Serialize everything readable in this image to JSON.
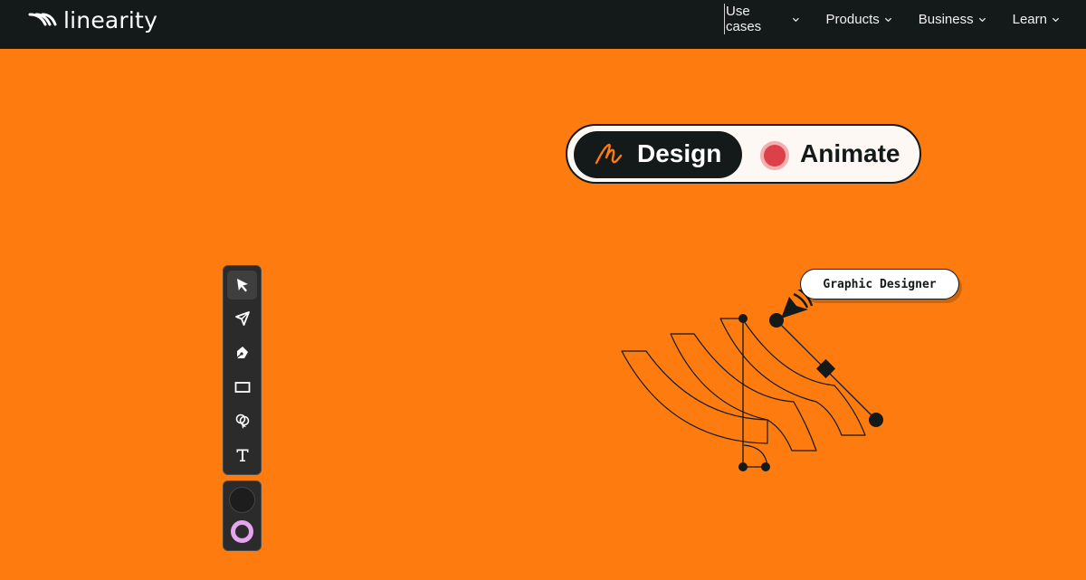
{
  "header": {
    "brand": "linearity",
    "nav": [
      {
        "label": "Use cases"
      },
      {
        "label": "Products"
      },
      {
        "label": "Business"
      },
      {
        "label": "Learn"
      }
    ]
  },
  "hero": {
    "toggle": {
      "design_label": "Design",
      "animate_label": "Animate",
      "selected": "Design"
    }
  },
  "toolbar": {
    "tools": [
      {
        "name": "select-tool",
        "icon": "arrow-pointer-icon",
        "active": true
      },
      {
        "name": "direct-select-tool",
        "icon": "node-arrow-icon",
        "active": false
      },
      {
        "name": "pen-tool",
        "icon": "pen-nib-icon",
        "active": false
      },
      {
        "name": "rectangle-tool",
        "icon": "rectangle-icon",
        "active": false
      },
      {
        "name": "shape-builder-tool",
        "icon": "shape-builder-icon",
        "active": false
      },
      {
        "name": "text-tool",
        "icon": "text-t-icon",
        "active": false
      }
    ],
    "fill_color": "#1d1d1d",
    "stroke_color": "#e7a3ef"
  },
  "canvas": {
    "cursor_label": "Graphic Designer"
  },
  "colors": {
    "background": "#fd7b0f",
    "navbar": "#131a19",
    "accent_red": "#dc4149"
  }
}
